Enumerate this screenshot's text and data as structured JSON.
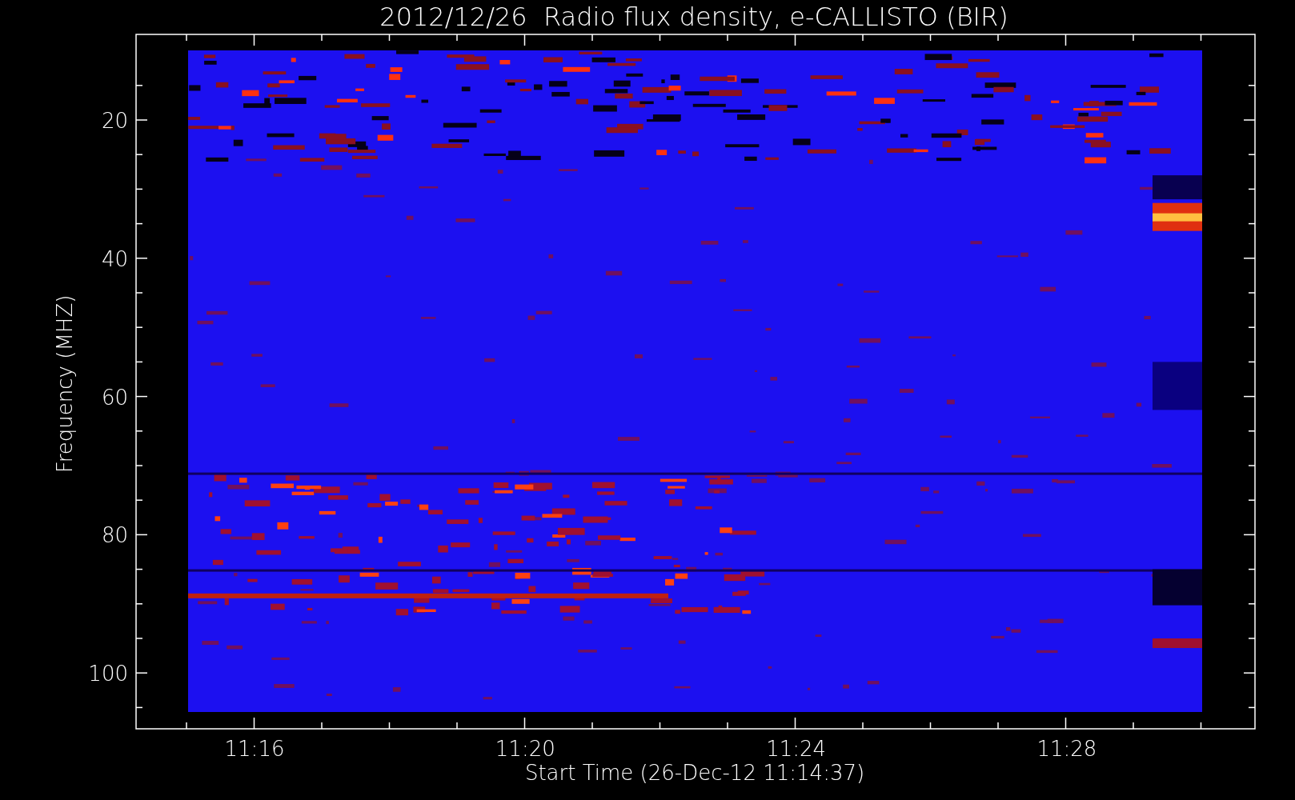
{
  "title": "2012/12/26  Radio flux density, e-CALLISTO (BIR)",
  "y_axis": {
    "label": "Frequency (MHZ)",
    "tick_labels": [
      "20",
      "40",
      "60",
      "80",
      "100"
    ]
  },
  "x_axis": {
    "label": "Start Time (26-Dec-12 11:14:37)",
    "tick_labels": [
      "11:16",
      "11:20",
      "11:24",
      "11:28"
    ]
  }
}
